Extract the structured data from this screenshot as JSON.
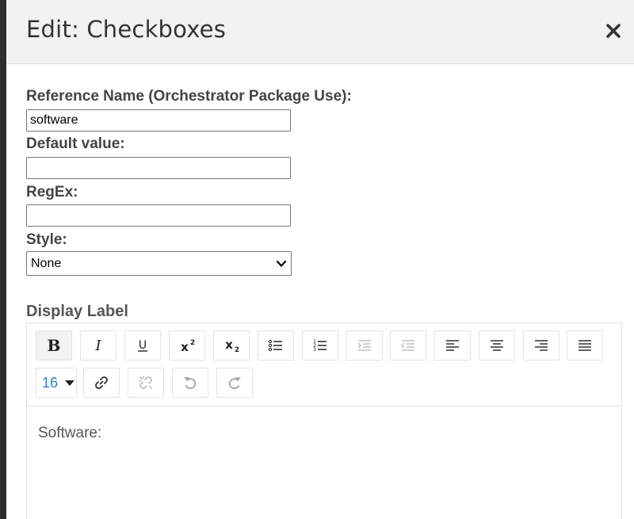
{
  "dialog": {
    "title": "Edit: Checkboxes",
    "close_icon": "close-icon"
  },
  "form": {
    "reference_name": {
      "label": "Reference Name (Orchestrator Package Use):",
      "value": "software"
    },
    "default_value": {
      "label": "Default value:",
      "value": ""
    },
    "regex": {
      "label": "RegEx:",
      "value": ""
    },
    "style": {
      "label": "Style:",
      "selected": "None"
    }
  },
  "display_label": {
    "title": "Display Label",
    "toolbar": {
      "buttons": [
        {
          "name": "bold-icon",
          "state": "active"
        },
        {
          "name": "italic-icon",
          "state": "enabled"
        },
        {
          "name": "underline-icon",
          "state": "enabled"
        },
        {
          "name": "superscript-icon",
          "state": "enabled"
        },
        {
          "name": "subscript-icon",
          "state": "enabled"
        },
        {
          "name": "bullet-list-icon",
          "state": "enabled"
        },
        {
          "name": "numbered-list-icon",
          "state": "enabled"
        },
        {
          "name": "indent-icon",
          "state": "disabled"
        },
        {
          "name": "outdent-icon",
          "state": "disabled"
        },
        {
          "name": "align-left-icon",
          "state": "enabled"
        },
        {
          "name": "align-center-icon",
          "state": "enabled"
        },
        {
          "name": "align-right-icon",
          "state": "enabled"
        },
        {
          "name": "justify-icon",
          "state": "enabled"
        },
        {
          "name": "link-icon",
          "state": "enabled"
        },
        {
          "name": "unlink-icon",
          "state": "disabled"
        },
        {
          "name": "undo-icon",
          "state": "disabled"
        },
        {
          "name": "redo-icon",
          "state": "disabled"
        }
      ],
      "font_size": "16"
    },
    "content": "Software:"
  },
  "colors": {
    "header_bg": "#f2f2f2",
    "text": "#333333",
    "label": "#444444",
    "accent": "#2b7fd6",
    "disabled_icon": "#bbbbbb"
  }
}
